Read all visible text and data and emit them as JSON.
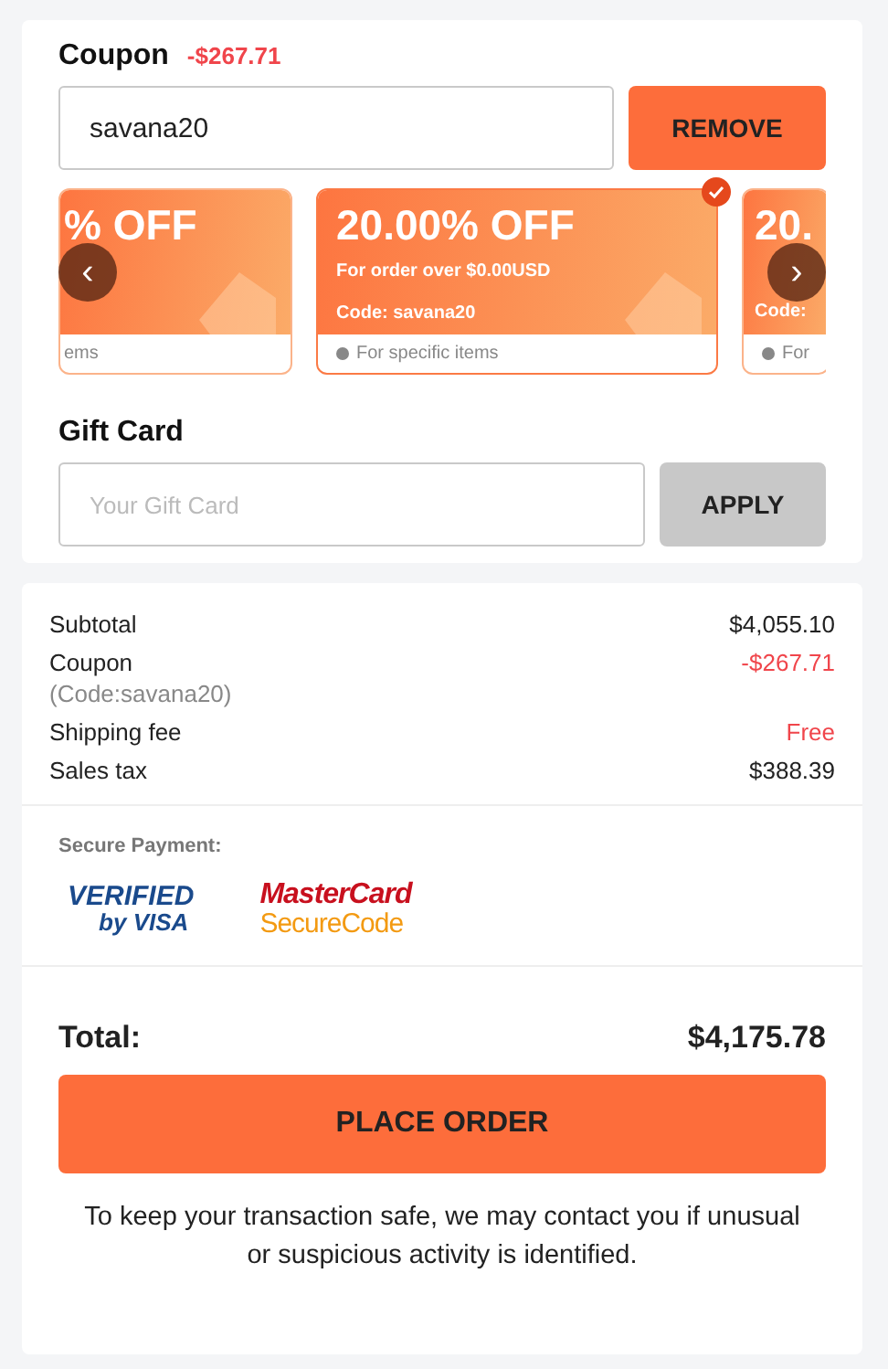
{
  "coupon": {
    "title": "Coupon",
    "discount": "-$267.71",
    "value": "savana20",
    "button": "REMOVE"
  },
  "coupon_cards": [
    {
      "title": "% OFF",
      "footer": "ems",
      "selected": false
    },
    {
      "title": "20.00% OFF",
      "condition": "For order over $0.00USD",
      "code": "Code: savana20",
      "footer": "For specific items",
      "selected": true
    },
    {
      "title": "20.",
      "code": "Code:",
      "footer": "For",
      "selected": false
    }
  ],
  "carousel_arrows": [
    "‹",
    "›"
  ],
  "gift_card": {
    "title": "Gift Card",
    "placeholder": "Your Gift Card",
    "button": "APPLY",
    "button_disabled": true
  },
  "summary": [
    {
      "label": "Subtotal",
      "value": "$4,055.10",
      "color": "#222222"
    },
    {
      "label": "Coupon",
      "note": "(Code:savana20)",
      "value": "-$267.71",
      "color": "#f0454b"
    },
    {
      "label": "Shipping fee",
      "value": "Free",
      "color": "#f0454b"
    },
    {
      "label": "Sales tax",
      "value": "$388.39",
      "color": "#222222"
    }
  ],
  "secure_payment": {
    "title": "Secure Payment:",
    "logos": [
      {
        "kind": "visa",
        "lines": [
          "VERIFIED",
          "by VISA"
        ]
      },
      {
        "kind": "mastercard",
        "lines": [
          "MasterCard",
          "SecureCode"
        ]
      }
    ]
  },
  "total": {
    "label": "Total:",
    "value": "$4,175.78"
  },
  "place_order": "PLACE ORDER",
  "notice": "To keep your transaction safe, we may contact you if unusual or suspicious activity is identified."
}
